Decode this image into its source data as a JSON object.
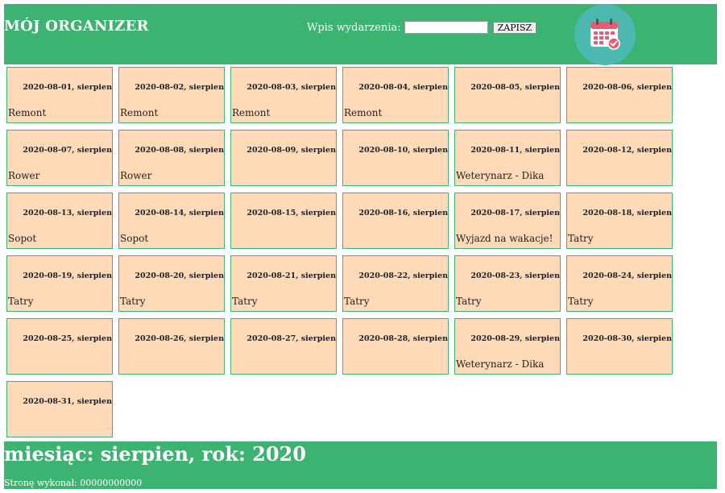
{
  "header": {
    "title": "MÓJ ORGANIZER",
    "event_label": "Wpis wydarzenia:",
    "event_input_value": "",
    "save_button": "ZAPISZ",
    "logo_icon": "calendar-check-icon"
  },
  "days": [
    {
      "date": "2020-08-01, sierpien",
      "event": "Remont"
    },
    {
      "date": "2020-08-02, sierpien",
      "event": "Remont"
    },
    {
      "date": "2020-08-03, sierpien",
      "event": "Remont"
    },
    {
      "date": "2020-08-04, sierpien",
      "event": "Remont"
    },
    {
      "date": "2020-08-05, sierpien",
      "event": ""
    },
    {
      "date": "2020-08-06, sierpien",
      "event": ""
    },
    {
      "date": "2020-08-07, sierpien",
      "event": "Rower"
    },
    {
      "date": "2020-08-08, sierpien",
      "event": "Rower"
    },
    {
      "date": "2020-08-09, sierpien",
      "event": ""
    },
    {
      "date": "2020-08-10, sierpien",
      "event": ""
    },
    {
      "date": "2020-08-11, sierpien",
      "event": "Weterynarz - Dika"
    },
    {
      "date": "2020-08-12, sierpien",
      "event": ""
    },
    {
      "date": "2020-08-13, sierpien",
      "event": "Sopot"
    },
    {
      "date": "2020-08-14, sierpien",
      "event": "Sopot"
    },
    {
      "date": "2020-08-15, sierpien",
      "event": ""
    },
    {
      "date": "2020-08-16, sierpien",
      "event": ""
    },
    {
      "date": "2020-08-17, sierpien",
      "event": "Wyjazd na wakacje!"
    },
    {
      "date": "2020-08-18, sierpien",
      "event": "Tatry"
    },
    {
      "date": "2020-08-19, sierpien",
      "event": "Tatry"
    },
    {
      "date": "2020-08-20, sierpien",
      "event": "Tatry"
    },
    {
      "date": "2020-08-21, sierpien",
      "event": "Tatry"
    },
    {
      "date": "2020-08-22, sierpien",
      "event": "Tatry"
    },
    {
      "date": "2020-08-23, sierpien",
      "event": "Tatry"
    },
    {
      "date": "2020-08-24, sierpien",
      "event": "Tatry"
    },
    {
      "date": "2020-08-25, sierpien",
      "event": ""
    },
    {
      "date": "2020-08-26, sierpien",
      "event": ""
    },
    {
      "date": "2020-08-27, sierpien",
      "event": ""
    },
    {
      "date": "2020-08-28, sierpien",
      "event": ""
    },
    {
      "date": "2020-08-29, sierpien",
      "event": "Weterynarz - Dika"
    },
    {
      "date": "2020-08-30, sierpien",
      "event": ""
    },
    {
      "date": "2020-08-31, sierpien",
      "event": ""
    }
  ],
  "footer": {
    "month_line": "miesiąc: sierpien, rok: 2020",
    "credits": "Stronę wykonał: 00000000000"
  },
  "colors": {
    "banner": "#3cb371",
    "day_cell": "#ffdab9",
    "logo_circle": "#4cb8b0",
    "calendar_red": "#e75c74"
  }
}
